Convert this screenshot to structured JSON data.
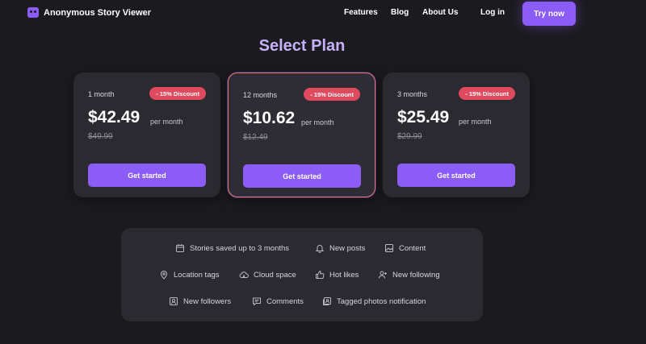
{
  "header": {
    "app_title": "Anonymous Story Viewer",
    "nav": [
      "Features",
      "Blog",
      "About Us"
    ],
    "login": "Log in",
    "cta": "Try now"
  },
  "page_title": "Select Plan",
  "plans": [
    {
      "period": "1 month",
      "badge": "- 15% Discount",
      "price": "$42.49",
      "per": "per month",
      "old_price": "$49.99",
      "cta": "Get started",
      "featured": false
    },
    {
      "period": "12 months",
      "badge": "- 15% Discount",
      "price": "$10.62",
      "per": "per month",
      "old_price": "$12.49",
      "cta": "Get started",
      "featured": true
    },
    {
      "period": "3 months",
      "badge": "- 15% Discount",
      "price": "$25.49",
      "per": "per month",
      "old_price": "$29.99",
      "cta": "Get started",
      "featured": false
    }
  ],
  "features": [
    {
      "label": "Stories saved up to 3 months",
      "icon": "calendar-icon"
    },
    {
      "label": "New posts",
      "icon": "bell-icon"
    },
    {
      "label": "Content",
      "icon": "image-icon"
    },
    {
      "label": "Location tags",
      "icon": "location-pin-icon"
    },
    {
      "label": "Cloud space",
      "icon": "cloud-icon"
    },
    {
      "label": "Hot likes",
      "icon": "thumbs-up-icon"
    },
    {
      "label": "New following",
      "icon": "user-plus-icon"
    },
    {
      "label": "New followers",
      "icon": "user-card-icon"
    },
    {
      "label": "Comments",
      "icon": "comment-icon"
    },
    {
      "label": "Tagged photos notification",
      "icon": "tagged-photo-icon"
    }
  ],
  "colors": {
    "background": "#1b1a1f",
    "card": "#2b2a31",
    "accent": "#8b5cf6",
    "title": "#c4b1f8",
    "badge": "#e04a5f"
  }
}
